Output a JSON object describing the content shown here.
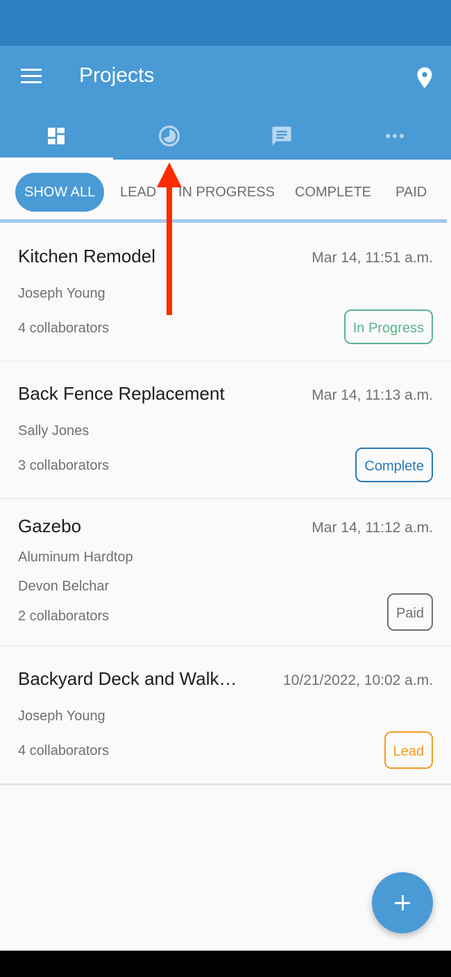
{
  "app_bar": {
    "title": "Projects",
    "background": "#4a9ad6",
    "icons": {
      "menu": "menu-icon",
      "location": "location-pin-icon"
    }
  },
  "tabs": [
    {
      "name": "dashboard",
      "icon": "dashboard-icon",
      "active": true
    },
    {
      "name": "timeline",
      "icon": "clock-icon",
      "active": false
    },
    {
      "name": "messages",
      "icon": "message-icon",
      "active": false
    },
    {
      "name": "more",
      "icon": "more-horiz-icon",
      "active": false
    }
  ],
  "filters": [
    {
      "label": "SHOW ALL",
      "active": true
    },
    {
      "label": "LEAD",
      "active": false
    },
    {
      "label": "IN PROGRESS",
      "active": false
    },
    {
      "label": "COMPLETE",
      "active": false
    },
    {
      "label": "PAID",
      "active": false
    }
  ],
  "projects": [
    {
      "name": "Kitchen Remodel",
      "date": "Mar 14, 11:51 a.m.",
      "description": "",
      "client": "Joseph Young",
      "collaborators": "4 collaborators",
      "status": "In Progress",
      "status_color": "#5cb38a"
    },
    {
      "name": "Back Fence Replacement",
      "date": "Mar 14, 11:13 a.m.",
      "description": "",
      "client": "Sally Jones",
      "collaborators": "3 collaborators",
      "status": "Complete",
      "status_color": "#2a7ab8"
    },
    {
      "name": "Gazebo",
      "date": "Mar 14, 11:12 a.m.",
      "description": "Aluminum Hardtop",
      "client": "Devon Belchar",
      "collaborators": "2 collaborators",
      "status": "Paid",
      "status_color": "#707070"
    },
    {
      "name": "Backyard Deck and Walkway",
      "date": "10/21/2022, 10:02 a.m.",
      "description": "",
      "client": "Joseph Young",
      "collaborators": "4 collaborators",
      "status": "Lead",
      "status_color": "#f29a1f"
    }
  ],
  "fab": {
    "icon": "plus-icon",
    "label": "Add project"
  },
  "annotation": {
    "icon": "red-arrow-icon",
    "color": "#ff2a00"
  }
}
